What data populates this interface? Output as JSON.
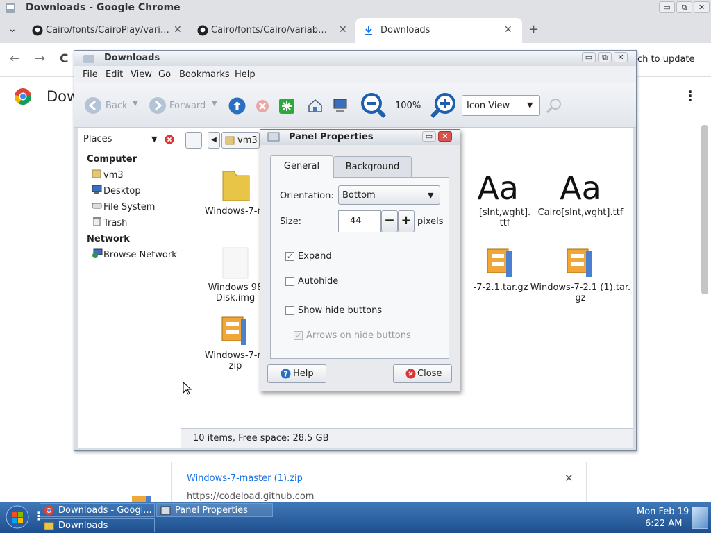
{
  "chrome": {
    "window_title": "Downloads - Google Chrome",
    "tabs": [
      {
        "label": "Cairo/fonts/CairoPlay/variable"
      },
      {
        "label": "Cairo/fonts/Cairo/variable/Ca"
      },
      {
        "label": "Downloads"
      }
    ],
    "update_text": "ch to update",
    "page_title": "Dow",
    "min_glyph": "▭",
    "max_glyph": "⧉",
    "close_glyph": "✕",
    "new_tab_glyph": "+",
    "menu_glyph": "⋮",
    "back_glyph": "←",
    "forward_glyph": "→",
    "reload_glyph": "C",
    "tab_menu_glyph": "⌄"
  },
  "file_manager": {
    "title": "Downloads",
    "menu": [
      "File",
      "Edit",
      "View",
      "Go",
      "Bookmarks",
      "Help"
    ],
    "toolbar": {
      "back": "Back",
      "forward": "Forward",
      "zoom": "100%",
      "view_mode": "Icon View"
    },
    "places": {
      "header": "Places",
      "computer_label": "Computer",
      "computer_items": [
        "vm3",
        "Desktop",
        "File System",
        "Trash"
      ],
      "network_label": "Network",
      "network_items": [
        "Browse Network"
      ]
    },
    "path_button": "vm3",
    "files": [
      {
        "name": "Windows-7-m"
      },
      {
        "name": "[slnt,wght].",
        "name2": "ttf"
      },
      {
        "name": "Cairo[slnt,wght].ttf"
      },
      {
        "name": "Windows 98",
        "name2": "Disk.img"
      },
      {
        "name": "-7-2.1.tar.gz"
      },
      {
        "name": "Windows-7-2.1 (1).tar.",
        "name2": "gz"
      },
      {
        "name": "Windows-7-m",
        "name2": "zip"
      }
    ],
    "font_preview": "Aa",
    "status": "10 items, Free space: 28.5 GB"
  },
  "dialog": {
    "title": "Panel Properties",
    "tabs": [
      "General",
      "Background"
    ],
    "orientation_label": "Orientation:",
    "orientation_value": "Bottom",
    "size_label": "Size:",
    "size_value": "44",
    "size_unit": "pixels",
    "minus": "—",
    "plus": "+",
    "options": [
      {
        "label": "Expand",
        "checked": true
      },
      {
        "label": "Autohide",
        "checked": false
      },
      {
        "label": "Show hide buttons",
        "checked": false
      },
      {
        "label": "Arrows on hide buttons",
        "checked": true
      }
    ],
    "help_button": "Help",
    "close_button": "Close",
    "check_glyph": "✓"
  },
  "download_bar": {
    "file_name": "Windows-7-master (1).zip",
    "source": "https://codeload.github.com"
  },
  "taskbar": {
    "items": [
      {
        "label": "Downloads - Googl..."
      },
      {
        "label": "Panel Properties"
      },
      {
        "label": "Downloads"
      }
    ],
    "clock_date": "Mon Feb 19",
    "clock_time": "6:22 AM"
  }
}
